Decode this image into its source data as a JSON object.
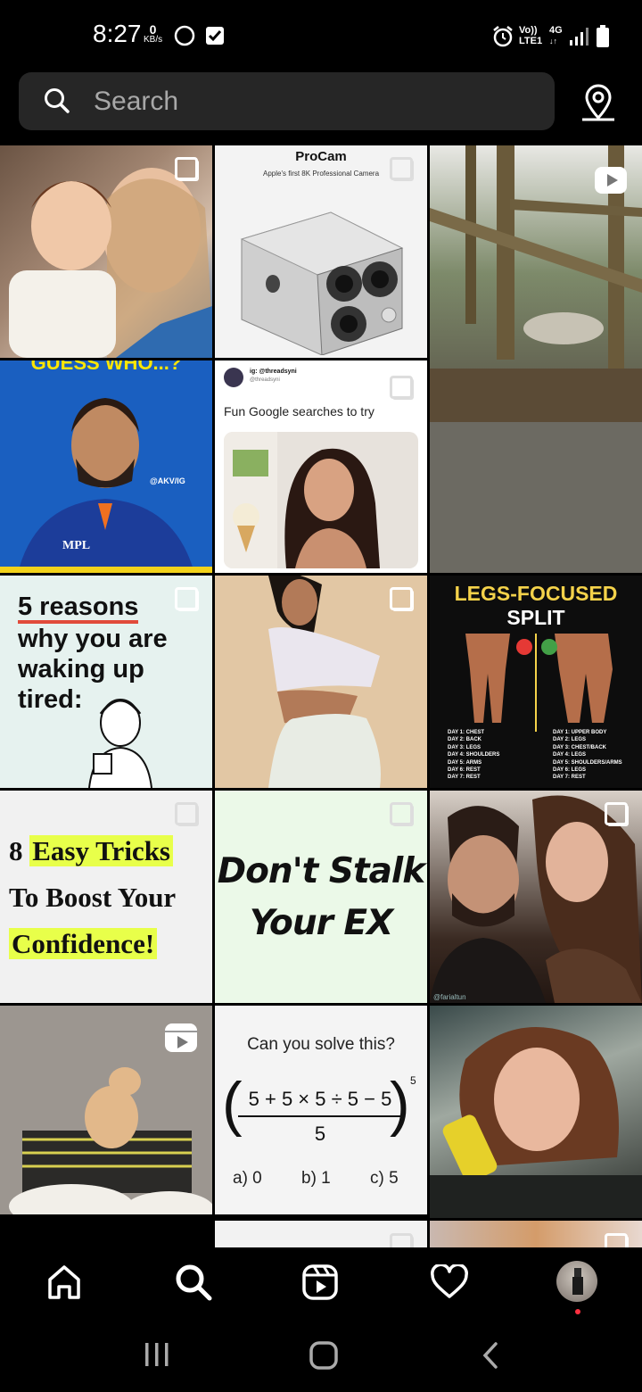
{
  "status_bar": {
    "time": "8:27",
    "net_speed_value": "0",
    "net_speed_unit": "KB/s",
    "volte_top": "Vo))",
    "volte_bottom": "LTE1",
    "network_type": "4G"
  },
  "search": {
    "placeholder": "Search"
  },
  "tiles": {
    "procam_brand": "ProCam",
    "procam_tagline": "Apple's first 8K Professional Camera",
    "guess_who": "GUESS WHO...?",
    "akv_handle": "@AKV/IG",
    "jersey_brand": "MPL",
    "tweet_handle": "ig: @threadsyni",
    "tweet_subhandle": "@threadsyni",
    "tweet_text": "Fun Google searches to try",
    "reasons_line1": "5 reasons",
    "reasons_line2": "why you are",
    "reasons_line3": "waking up",
    "reasons_line4": "tired:",
    "legs_title1": "LEGS-FOCUSED",
    "legs_title2": "SPLIT",
    "legs_left": [
      "DAY 1: CHEST",
      "DAY 2: BACK",
      "DAY 3: LEGS",
      "DAY 4: SHOULDERS",
      "DAY 5: ARMS",
      "DAY 6: REST",
      "DAY 7: REST"
    ],
    "legs_right": [
      "DAY 1: UPPER BODY",
      "DAY 2: LEGS",
      "DAY 3: CHEST/BACK",
      "DAY 4: LEGS",
      "DAY 5: SHOULDERS/ARMS",
      "DAY 6: LEGS",
      "DAY 7: REST"
    ],
    "tricks_prefix": "8 ",
    "tricks_highlight": "Easy Tricks",
    "tricks_line2": "To Boost Your",
    "tricks_line3": "Confidence!",
    "stalk_line1": "Don't Stalk",
    "stalk_line2": "Your EX",
    "couple_handle": "@farialtun",
    "math_question": "Can you solve this?",
    "math_numerator": "5 + 5 × 5 ÷ 5 − 5",
    "math_denominator": "5",
    "math_exponent": "5",
    "math_opt_a": "a) 0",
    "math_opt_b": "b) 1",
    "math_opt_c": "c) 5"
  },
  "bottom_nav": {
    "items": [
      "home-icon",
      "search-icon",
      "reels-icon",
      "heart-icon",
      "profile-avatar"
    ]
  },
  "colors": {
    "background": "#000000",
    "search_bg": "#262626",
    "highlight_yellow": "#e8ff4a",
    "notification_dot": "#ff3040"
  }
}
